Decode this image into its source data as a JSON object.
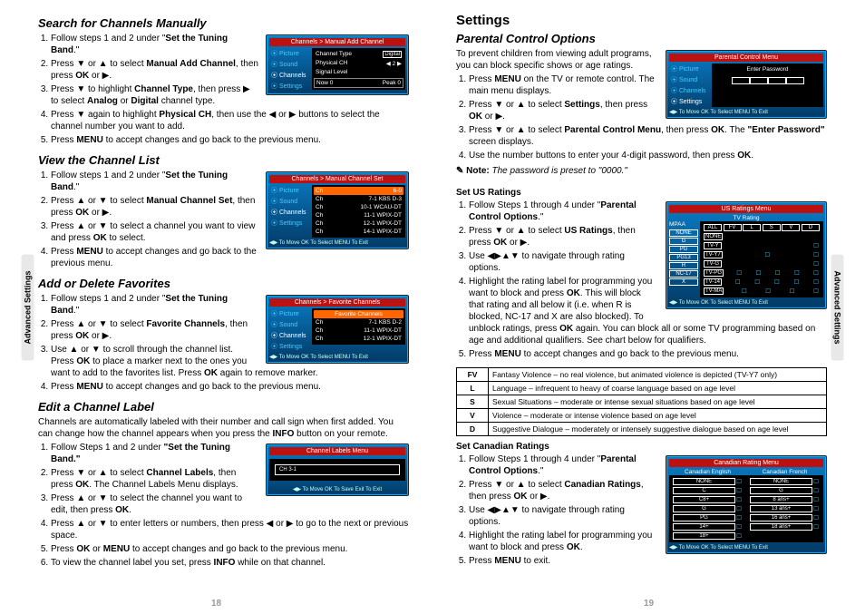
{
  "side_tab": "Advanced Settings",
  "page_left_num": "18",
  "page_right_num": "19",
  "left": {
    "search": {
      "heading": "Search for Channels Manually",
      "s1a": "Follow steps 1 and 2 under \"",
      "s1b": "Set the Tuning Band",
      "s1c": ".\"",
      "s2a": "Press ▼ or ▲ to select ",
      "s2b": "Manual Add Channel",
      "s2c": ", then press ",
      "s2d": "OK",
      "s2e": " or ▶.",
      "s3a": "Press ▼ to highlight ",
      "s3b": "Channel Type",
      "s3c": ", then press ▶ to select ",
      "s3d": "Analog",
      "s3e": " or ",
      "s3f": "Digital",
      "s3g": " channel type.",
      "s4a": "Press ▼ again to highlight ",
      "s4b": "Physical CH",
      "s4c": ", then use the ◀ or ▶ buttons to select the channel number you want to add.",
      "s5a": "Press ",
      "s5b": "MENU",
      "s5c": " to accept changes and go back to the previous menu."
    },
    "view": {
      "heading": "View the Channel List",
      "s1a": "Follow steps 1 and 2 under \"",
      "s1b": "Set the Tuning Band",
      "s1c": ".\"",
      "s2a": "Press ▲ or ▼ to select ",
      "s2b": "Manual Channel Set",
      "s2c": ", then press ",
      "s2d": "OK",
      "s2e": " or ▶.",
      "s3a": "Press ▲ or ▼ to select a channel you want to view and press ",
      "s3b": "OK",
      "s3c": " to select.",
      "s4a": "Press ",
      "s4b": "MENU",
      "s4c": " to accept changes and go back to the previous menu."
    },
    "fav": {
      "heading": "Add or Delete Favorites",
      "s1a": "Follow steps 1 and 2 under \"",
      "s1b": "Set the Tuning Band",
      "s1c": ".\"",
      "s2a": "Press ▲ or ▼ to select ",
      "s2b": "Favorite Channels",
      "s2c": ", then press ",
      "s2d": "OK",
      "s2e": " or ▶.",
      "s3a": "Use ▲ or ▼ to scroll through the channel list. Press ",
      "s3b": "OK",
      "s3c": " to place a marker next to the ones you want to add to the favorites list. Press ",
      "s3d": "OK",
      "s3e": " again to remove marker.",
      "s4a": "Press ",
      "s4b": "MENU",
      "s4c": " to accept changes and go back to the previous menu."
    },
    "edit": {
      "heading": "Edit a Channel Label",
      "intro_a": "Channels are automatically labeled with their number and call sign when first added. You can change how the channel appears when you press the ",
      "intro_b": "INFO",
      "intro_c": " button on your remote.",
      "s1a": "Follow Steps 1 and 2 under ",
      "s1b": "\"Set the Tuning Band.\"",
      "s2a": "Press ▼ or ▲ to select ",
      "s2b": "Channel Labels",
      "s2c": ", then press ",
      "s2d": "OK",
      "s2e": ". The Channel Labels Menu displays.",
      "s3a": "Press ▲ or ▼ to select the channel you want to edit, then press ",
      "s3b": "OK",
      "s3c": ".",
      "s4": "Press ▲ or ▼ to enter letters or numbers, then press ◀ or ▶ to go to the next or previous space.",
      "s5a": "Press ",
      "s5b": "OK",
      "s5c": " or ",
      "s5d": "MENU",
      "s5e": " to accept changes and go back to the previous menu.",
      "s6a": "To view the channel label you set, press ",
      "s6b": "INFO",
      "s6c": " while on that channel."
    },
    "scr_add": {
      "title": "Channels > Manual Add Channel",
      "m1": "⦿ Picture",
      "m2": "⦿ Sound",
      "m3": "⦿ Channels",
      "m4": "⦿ Settings",
      "r1a": "Channel Type",
      "r1b": "Digital",
      "r2a": "Physical CH",
      "r2b": "◀  2  ▶",
      "r3a": "Signal Level",
      "r4a": "Now    0",
      "r4b": "Peak    0"
    },
    "scr_list": {
      "title": "Channels > Manual Channel Set",
      "m1": "⦿ Picture",
      "m2": "⦿ Sound",
      "m3": "⦿ Channels",
      "m4": "⦿ Settings",
      "c1a": "Ch",
      "c1b": "6-0",
      "c2a": "Ch",
      "c2b": "7-1 KBS D-3",
      "c3a": "Ch",
      "c3b": "10-1 WCAU-DT",
      "c4a": "Ch",
      "c4b": "11-1 WPIX-DT",
      "c5a": "Ch",
      "c5b": "12-1 WPIX-DT",
      "c6a": "Ch",
      "c6b": "14-1 WPIX-DT",
      "footer": "◀▶ To Move    OK To Select    MENU To Exit"
    },
    "scr_fav": {
      "title": "Channels > Favorite Channels",
      "sub": "Favorite Channels",
      "m1": "⦿ Picture",
      "m2": "⦿ Sound",
      "m3": "⦿ Channels",
      "m4": "⦿ Settings",
      "c1a": "Ch",
      "c1b": "7-1 KBS D-2",
      "c2a": "Ch",
      "c2b": "11-1 WPIX-DT",
      "c3a": "Ch",
      "c3b": "12-1 WPIX-DT",
      "footer": "◀▶ To Move    OK To Select    MENU To Exit"
    },
    "scr_labels": {
      "title": "Channel Labels Menu",
      "field": "CH 3-1",
      "footer": "◀▶ To Move   OK To Save   Exit To Exit"
    }
  },
  "right": {
    "settings": "Settings",
    "parental": {
      "heading": "Parental Control Options",
      "intro": "To prevent children from viewing adult programs, you can block specific shows or age ratings.",
      "s1a": "Press ",
      "s1b": "MENU",
      "s1c": " on the TV or remote control. The main menu displays.",
      "s2a": "Press ▼ or ▲ to select ",
      "s2b": "Settings",
      "s2c": ", then press ",
      "s2d": "OK",
      "s2e": " or ▶.",
      "s3a": "Press ▼ or ▲ to select ",
      "s3b": "Parental Control Menu",
      "s3c": ", then press ",
      "s3d": "OK",
      "s3e": ". The ",
      "s3f": "\"Enter Password\"",
      "s3g": " screen displays.",
      "s4a": "Use the number buttons to enter your 4-digit password, then press ",
      "s4b": "OK",
      "s4c": ".",
      "note_label": "Note:",
      "note_body": " The password is preset to \"0000.\""
    },
    "us": {
      "heading": "Set US Ratings",
      "s1a": "Follow Steps 1 through 4 under \"",
      "s1b": "Parental Control Options",
      "s1c": ".\"",
      "s2a": "Press ▼ or ▲ to select ",
      "s2b": "US Ratings",
      "s2c": ", then press ",
      "s2d": "OK",
      "s2e": " or ▶.",
      "s3": "Use ◀▶▲▼ to navigate through rating options.",
      "s4a": "Highlight the rating label for programming you want to block and press ",
      "s4b": "OK",
      "s4c": ". This will block that rating and all below it (i.e. when R is blocked, NC-17 and X are also blocked). To unblock ratings, press ",
      "s4d": "OK",
      "s4e": " again. You can block all or some TV programming based on age and additional qualifiers. See chart below for qualifiers.",
      "s5a": "Press ",
      "s5b": "MENU",
      "s5c": " to accept changes and go back to the previous menu."
    },
    "table": {
      "r1a": "FV",
      "r1b": "Fantasy Violence – no real violence, but animated violence is depicted (TV-Y7 only)",
      "r2a": "L",
      "r2b": "Language – infrequent to heavy of coarse language based on age level",
      "r3a": "S",
      "r3b": "Sexual Situations – moderate or intense sexual situations based on age level",
      "r4a": "V",
      "r4b": "Violence – moderate or intense violence based on age level",
      "r5a": "D",
      "r5b": "Suggestive Dialogue – moderately or intensely suggestive dialogue based on age level"
    },
    "can": {
      "heading": "Set Canadian Ratings",
      "s1a": "Follow Steps 1 through 4 under \"",
      "s1b": "Parental Control Options",
      "s1c": ".\"",
      "s2a": "Press ▼ or ▲ to select ",
      "s2b": "Canadian Ratings",
      "s2c": ", then press ",
      "s2d": "OK",
      "s2e": " or ▶.",
      "s3": "Use ◀▶▲▼ to navigate through rating options.",
      "s4a": "Highlight the rating label for programming you want to block and press ",
      "s4b": "OK",
      "s4c": ".",
      "s5a": "Press ",
      "s5b": "MENU",
      "s5c": " to exit."
    },
    "scr_parental": {
      "title": "Parental Control Menu",
      "m1": "⦿ Picture",
      "m2": "⦿ Sound",
      "m3": "⦿ Channels",
      "m4": "⦿ Settings",
      "label": "Enter Password",
      "footer": "◀▶ To Move    OK To Select    MENU To Exit"
    },
    "scr_us": {
      "title": "US Ratings Menu",
      "sub": "TV Rating",
      "mpaa": "MPAA",
      "h_all": "ALL",
      "h_fv": "FV",
      "h_l": "L",
      "h_s": "S",
      "h_v": "V",
      "h_d": "D",
      "l_none": "NONE",
      "l_g": "G",
      "l_pg": "PG",
      "l_pg13": "PG13",
      "l_r": "R",
      "l_nc17": "NC-17",
      "l_x": "X",
      "t_none": "NONE",
      "t_tvy": "TV-Y",
      "t_tvy7": "TV-Y7",
      "t_tvg": "TV-G",
      "t_tvpg": "TV-PG",
      "t_tv14": "TV-14",
      "t_tvma": "TV-MA",
      "footer": "◀▶ To Move    OK To Select    MENU To Exit"
    },
    "scr_can": {
      "title": "Canadian Rating Menu",
      "h_en": "Canadian English",
      "h_fr": "Canadian French",
      "e_none": "NONE",
      "e_c": "C",
      "e_c8": "C8+",
      "e_g": "G",
      "e_pg": "PG",
      "e_14": "14+",
      "e_18": "18+",
      "f_none": "NONE",
      "f_g": "G",
      "f_8": "8 ans+",
      "f_13": "13 ans+",
      "f_16": "16 ans+",
      "f_18": "18 ans+",
      "footer": "◀▶ To Move    OK To Select    MENU To Exit"
    }
  }
}
